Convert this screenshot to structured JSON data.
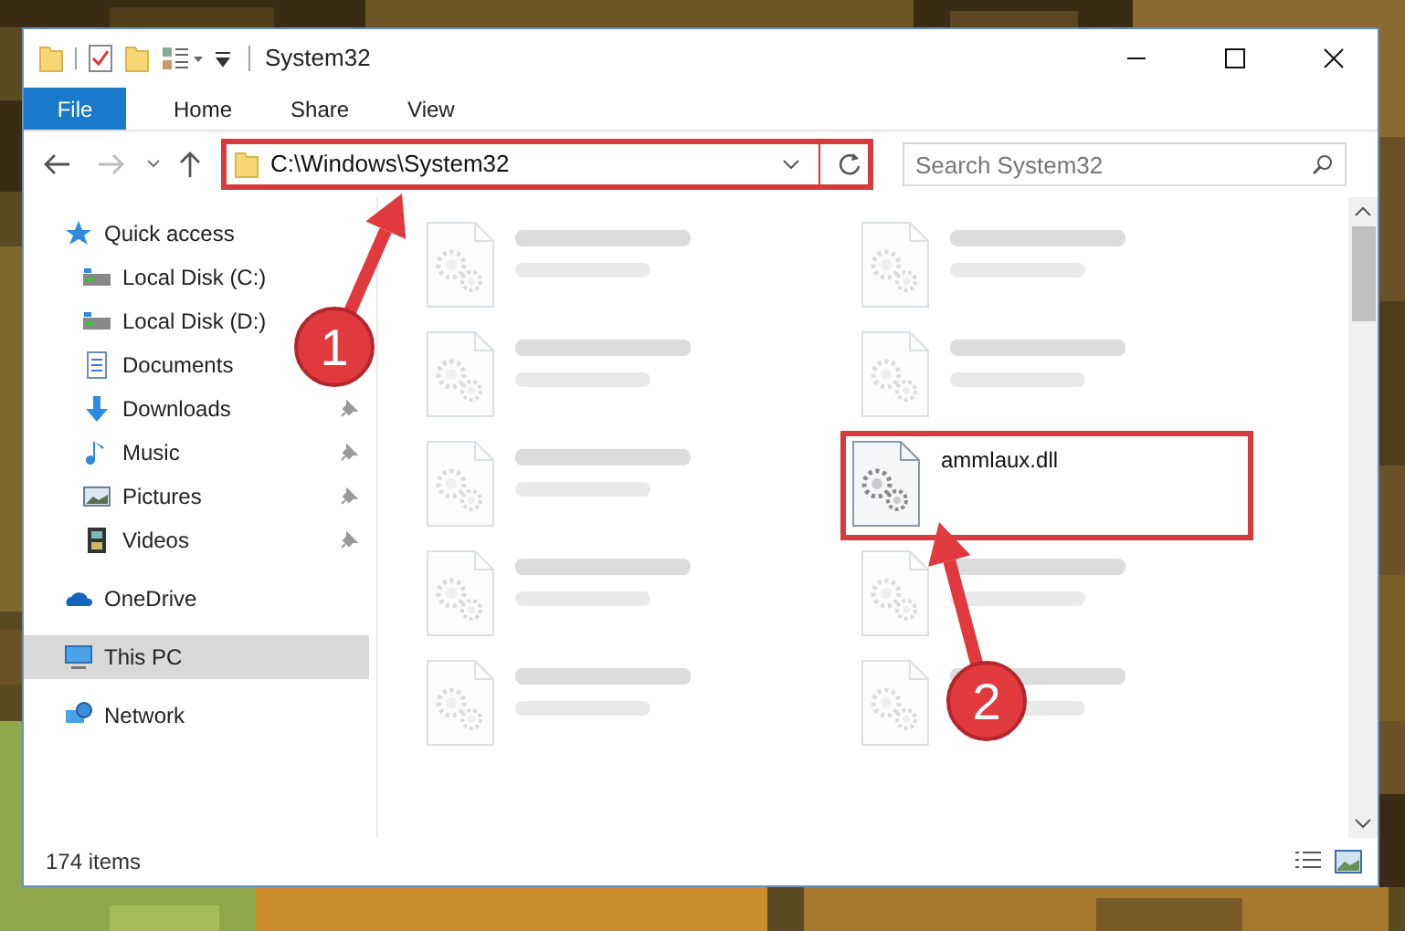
{
  "window": {
    "title": "System32"
  },
  "ribbon_tabs": [
    {
      "label": "File",
      "selected": true
    },
    {
      "label": "Home",
      "selected": false
    },
    {
      "label": "Share",
      "selected": false
    },
    {
      "label": "View",
      "selected": false
    }
  ],
  "address_bar": {
    "path": "C:\\Windows\\System32",
    "highlighted": true
  },
  "search": {
    "placeholder": "Search System32"
  },
  "sidebar": {
    "items": [
      {
        "label": "Quick access",
        "kind": "star",
        "pinned": false,
        "selected": false,
        "children": [
          {
            "label": "Local Disk (C:)",
            "kind": "disk",
            "pinned": false,
            "selected": false
          },
          {
            "label": "Local Disk (D:)",
            "kind": "disk",
            "pinned": false,
            "selected": false
          },
          {
            "label": "Documents",
            "kind": "doc",
            "pinned": false,
            "selected": false
          },
          {
            "label": "Downloads",
            "kind": "download",
            "pinned": true,
            "selected": false
          },
          {
            "label": "Music",
            "kind": "music",
            "pinned": true,
            "selected": false
          },
          {
            "label": "Pictures",
            "kind": "pictures",
            "pinned": true,
            "selected": false
          },
          {
            "label": "Videos",
            "kind": "video",
            "pinned": true,
            "selected": false
          }
        ]
      },
      {
        "label": "OneDrive",
        "kind": "cloud",
        "pinned": false,
        "selected": false
      },
      {
        "label": "This PC",
        "kind": "pc",
        "pinned": false,
        "selected": true
      },
      {
        "label": "Network",
        "kind": "network",
        "pinned": false,
        "selected": false
      }
    ]
  },
  "files": [
    {
      "kind": "blurred",
      "highlighted": false
    },
    {
      "kind": "blurred",
      "highlighted": false
    },
    {
      "kind": "blurred",
      "highlighted": false
    },
    {
      "kind": "blurred",
      "highlighted": false
    },
    {
      "kind": "blurred",
      "highlighted": false
    },
    {
      "kind": "file",
      "name": "ammlaux.dll",
      "highlighted": true
    },
    {
      "kind": "blurred",
      "highlighted": false
    },
    {
      "kind": "blurred",
      "highlighted": false
    },
    {
      "kind": "blurred",
      "highlighted": false
    },
    {
      "kind": "blurred",
      "highlighted": false
    }
  ],
  "status_bar": {
    "item_count": "174 items"
  },
  "annotations": [
    {
      "label": "1"
    },
    {
      "label": "2"
    }
  ]
}
